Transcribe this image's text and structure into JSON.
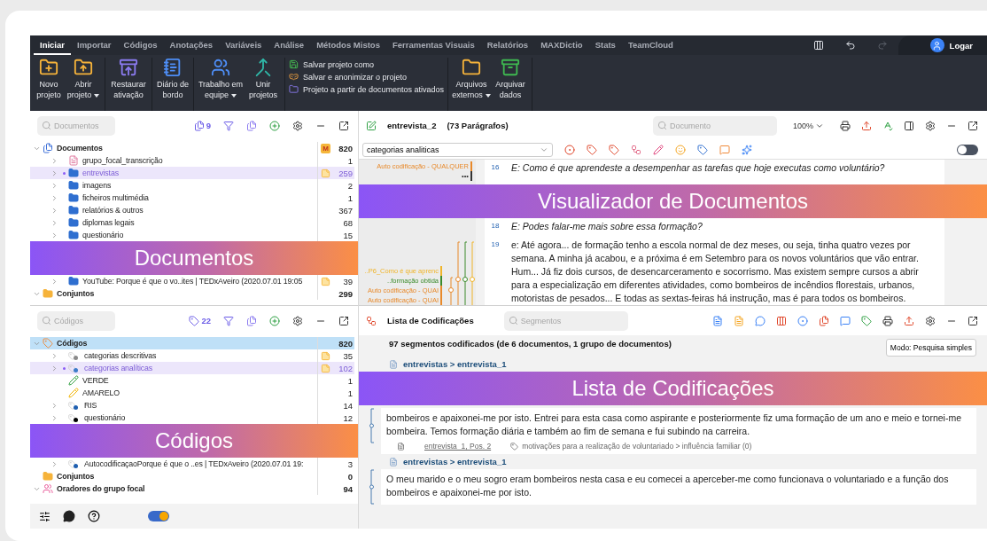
{
  "menu_tabs": [
    {
      "label": "Iniciar",
      "selected": true
    },
    {
      "label": "Importar",
      "selected": false
    },
    {
      "label": "Códigos",
      "selected": false
    },
    {
      "label": "Anotações",
      "selected": false
    },
    {
      "label": "Variáveis",
      "selected": false
    },
    {
      "label": "Análise",
      "selected": false
    },
    {
      "label": "Métodos Mistos",
      "selected": false
    },
    {
      "label": "Ferramentas Visuais",
      "selected": false
    },
    {
      "label": "Relatórios",
      "selected": false
    },
    {
      "label": "MAXDictio",
      "selected": false
    },
    {
      "label": "Stats",
      "selected": false
    },
    {
      "label": "TeamCloud",
      "selected": false
    }
  ],
  "login": {
    "label": "Logar"
  },
  "ribbon": [
    [
      {
        "kind": "large",
        "label": "Novo projeto",
        "dropdown": false
      },
      {
        "kind": "large",
        "label": "Abrir projeto",
        "dropdown": true
      }
    ],
    [
      {
        "kind": "large",
        "label": "Restaurar ativação",
        "dropdown": false
      }
    ],
    [
      {
        "kind": "large",
        "label": "Diário de bordo",
        "dropdown": false
      }
    ],
    [
      {
        "kind": "large",
        "label": "Trabalho em equipe",
        "dropdown": true
      },
      {
        "kind": "large",
        "label": "Unir projetos",
        "dropdown": false
      }
    ],
    [
      {
        "kind": "small",
        "label": "Salvar projeto como"
      },
      {
        "kind": "small",
        "label": "Salvar e anonimizar o projeto"
      },
      {
        "kind": "small",
        "label": "Projeto a partir de documentos ativados"
      }
    ],
    [
      {
        "kind": "large",
        "label": "Arquivos externos",
        "dropdown": true
      },
      {
        "kind": "large",
        "label": "Arquivar dados",
        "dropdown": false
      }
    ]
  ],
  "documents_panel": {
    "search": {
      "placeholder": "Documentos"
    },
    "active_count": "9",
    "tree": [
      {
        "kind": "documents-root",
        "label": "Documentos",
        "count": "820",
        "memo_badge": "M",
        "expanded": true,
        "selected": false,
        "children": [
          {
            "kind": "text",
            "label": "grupo_focal_transcrição",
            "count": "1",
            "expanded": false,
            "selected": false
          },
          {
            "kind": "folder",
            "label": "entrevistas",
            "count": "259",
            "memo": true,
            "activated": true,
            "expanded": false,
            "selected": false
          },
          {
            "kind": "folder",
            "label": "imagens",
            "count": "2",
            "expanded": false,
            "selected": false
          },
          {
            "kind": "folder",
            "label": "ficheiros multimédia",
            "count": "1",
            "expanded": false,
            "selected": false
          },
          {
            "kind": "folder",
            "label": "relatórios & outros",
            "count": "367",
            "expanded": false,
            "selected": false
          },
          {
            "kind": "folder",
            "label": "diplomas legais",
            "count": "68",
            "expanded": false,
            "selected": false
          },
          {
            "kind": "folder",
            "label": "questionário",
            "count": "15",
            "expanded": false,
            "selected": false
          },
          {
            "kind": "callout",
            "label": "Documentos"
          },
          {
            "kind": "folder",
            "label": "YouTube: Porque é que o vo..ites | TEDxAveiro (2020.07.01 19:05",
            "count": "39",
            "memo": true,
            "expanded": false,
            "selected": false
          }
        ]
      },
      {
        "kind": "sets",
        "label": "Conjuntos",
        "count": "299",
        "expanded": true,
        "selected": false
      }
    ]
  },
  "codes_panel": {
    "search": {
      "placeholder": "Códigos"
    },
    "active_count": "22",
    "tree": [
      {
        "kind": "codes-root",
        "label": "Códigos",
        "count": "820",
        "expanded": true,
        "selected": true,
        "children": [
          {
            "kind": "code",
            "label": "categorias descritivas",
            "count": "35",
            "memo": true,
            "color": "#8a8a8a",
            "expanded": false,
            "selected": false
          },
          {
            "kind": "code",
            "label": "categorias analíticas",
            "count": "102",
            "memo": true,
            "activated": true,
            "color": "#3d7cc9",
            "expanded": false,
            "selected": false
          },
          {
            "kind": "highlight",
            "label": "VERDE",
            "count": "1",
            "color": "#2e9e3e",
            "selected": false
          },
          {
            "kind": "highlight",
            "label": "AMARELO",
            "count": "1",
            "color": "#f2b300",
            "selected": false
          },
          {
            "kind": "code",
            "label": "RIS",
            "count": "14",
            "color": "#1f5fb0",
            "expanded": false,
            "selected": false
          },
          {
            "kind": "code",
            "label": "questionário",
            "count": "12",
            "color": "#000000",
            "expanded": false,
            "selected": false
          },
          {
            "kind": "callout",
            "label": "Códigos"
          },
          {
            "kind": "code",
            "label": "AutocodificaçaoPorque é que o ..es | TEDxAveiro (2020.07.01 19:",
            "count": "3",
            "color": "#1f5fb0",
            "expanded": false,
            "selected": false
          }
        ]
      },
      {
        "kind": "sets",
        "label": "Conjuntos",
        "count": "0",
        "selected": false
      },
      {
        "kind": "speakers",
        "label": "Oradores do grupo focal",
        "count": "94",
        "expanded": true,
        "selected": false
      }
    ]
  },
  "bottom_bar": {
    "mode_toggle": {
      "on": true
    }
  },
  "document_viewer": {
    "edit_mode": {
      "on": false
    },
    "title": "entrevista_2",
    "subtitle": "(73 Parágrafos)",
    "search": {
      "placeholder": "Documento"
    },
    "zoom": "100%",
    "code_select": "categorias analiticas",
    "paragraphs": [
      {
        "kind": "question",
        "number": "16",
        "text": "E: Como é que aprendeste a desempenhar as tarefas que hoje executas como voluntário?",
        "margin": [
          {
            "label": "Auto codificação - QUALQUER",
            "color": "#e8892a"
          },
          {
            "label": "•••",
            "color": "#333333"
          }
        ]
      },
      {
        "kind": "callout",
        "text": "Visualizador de Documentos"
      },
      {
        "kind": "question",
        "number": "18",
        "text": "E: Podes falar-me mais sobre essa formação?"
      },
      {
        "kind": "answer",
        "number": "19",
        "text": "e: Até agora... de formação tenho a escola normal de dez meses, ou seja, tinha quatro vezes por semana. A minha já acabou, e a próxima é em Setembro para os novos voluntários que vão entrar. Hum... Já fiz dois cursos, de desencarceramento e socorrismo. Mas existem sempre cursos a abrir para a especialização em diferentes atividades, como bombeiros de incêndios florestais, urbanos, motoristas de pesados... E todas as sextas-feiras há instrução, mas é para todos os bombeiros.",
        "margin": [
          {
            "label": "..P6_Como é que aprenc",
            "color": "#f0b429"
          },
          {
            "label": "..formação obtida",
            "color": "#3a8a2a"
          },
          {
            "label": "Auto codificação - QUAI",
            "color": "#e8892a"
          },
          {
            "label": "Auto codificação - QUAI",
            "color": "#e8892a"
          }
        ]
      }
    ]
  },
  "coding_list": {
    "title": "Lista de Codificações",
    "search": {
      "placeholder": "Segmentos"
    },
    "summary": "97 segmentos codificados (de 6 documentos, 1 grupo de documentos)",
    "mode": "Modo: Pesquisa simples",
    "items": [
      {
        "kind": "header",
        "text": "entrevistas > entrevista_1"
      },
      {
        "kind": "callout",
        "text": "Lista de Codificações"
      },
      {
        "kind": "segment",
        "text": "bombeiros e apaixonei-me por isto. Entrei para esta casa como aspirante e posteriormente fiz uma formação de um ano e meio e tornei-me bombeira. Temos formação diária e também ao fim de semana e fui subindo na carreira.",
        "source": "entrevista_1, Pos. 2",
        "code": "motivações para a realização de voluntariado > influência familiar (0)"
      },
      {
        "kind": "header",
        "text": "entrevistas > entrevista_1"
      },
      {
        "kind": "segment",
        "text": "O meu marido e o meu sogro eram bombeiros nesta casa e eu comecei a aperceber-me como funcionava o voluntariado e a função dos bombeiros e apaixonei-me por isto."
      }
    ]
  }
}
